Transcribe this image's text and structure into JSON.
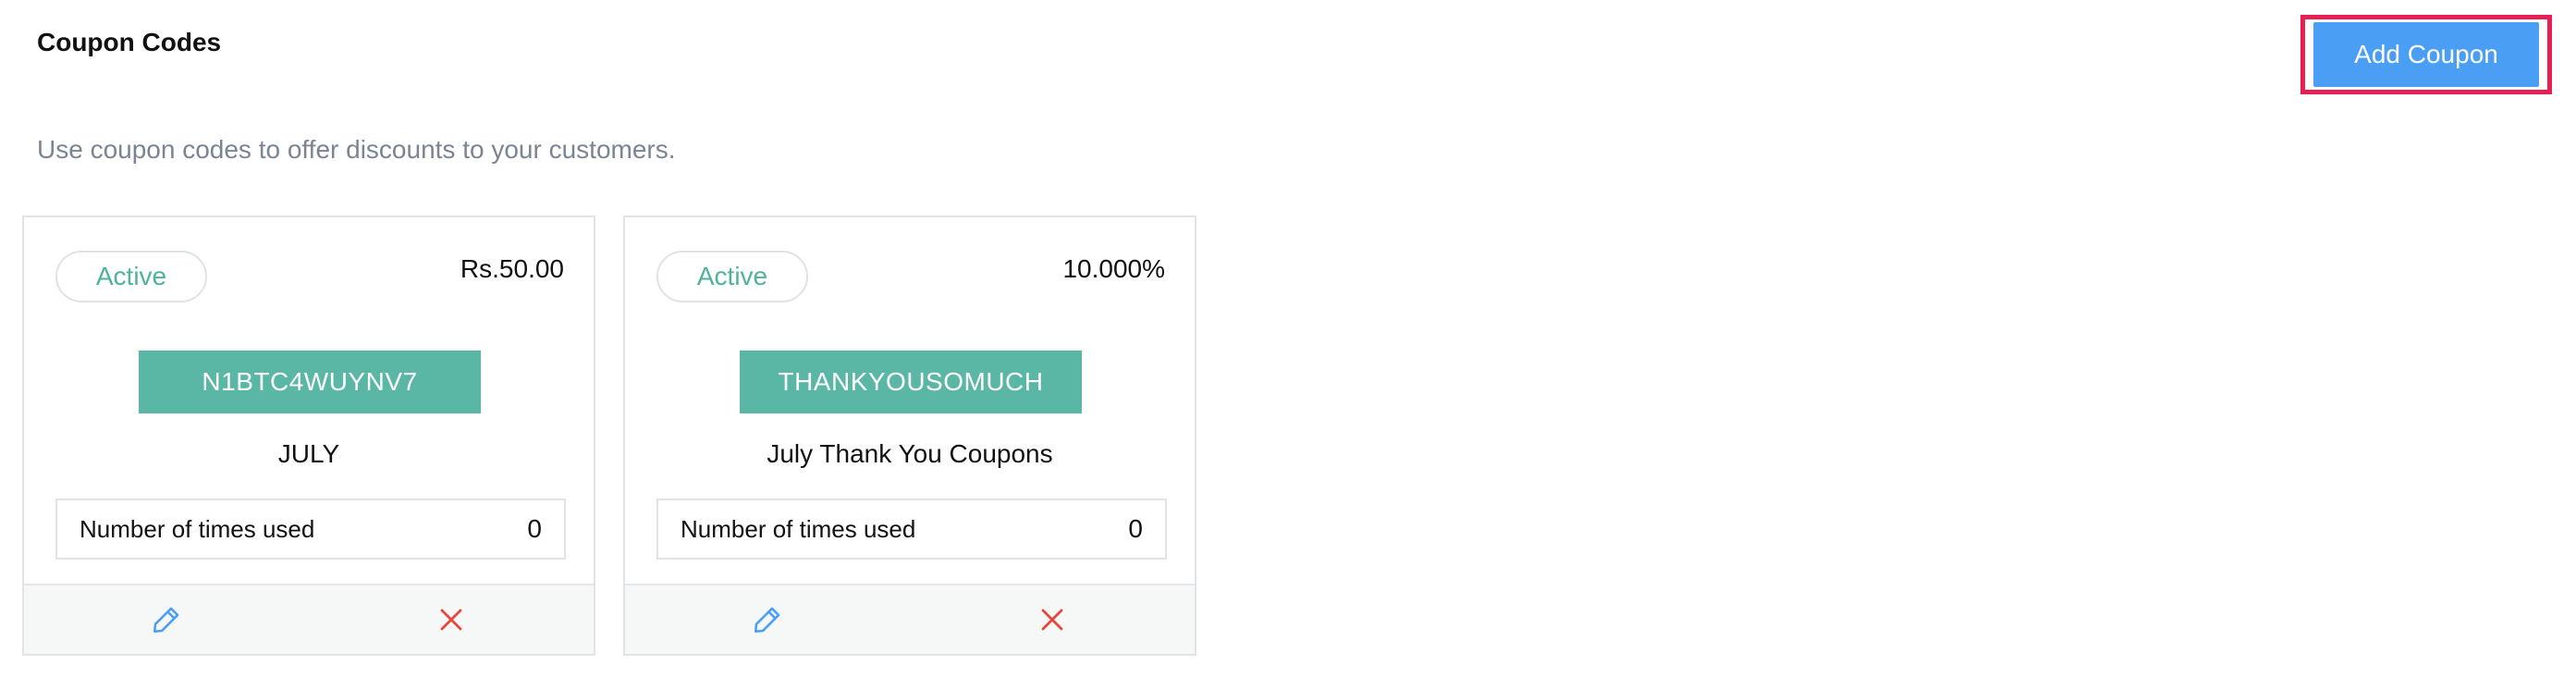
{
  "header": {
    "title": "Coupon Codes",
    "subtitle": "Use coupon codes to offer discounts to your customers.",
    "add_button_label": "Add Coupon"
  },
  "coupons": [
    {
      "status": "Active",
      "value": "Rs.50.00",
      "code": "N1BTC4WUYNV7",
      "name": "JULY",
      "usage_label": "Number of times used",
      "usage_count": "0"
    },
    {
      "status": "Active",
      "value": "10.000%",
      "code": "THANKYOUSOMUCH",
      "name": "July Thank You Coupons",
      "usage_label": "Number of times used",
      "usage_count": "0"
    }
  ],
  "icons": {
    "edit": "pencil-icon",
    "delete": "close-icon"
  },
  "colors": {
    "accent_blue": "#4a9ff5",
    "status_green": "#4fb29c",
    "code_bg": "#5bb7a5",
    "delete_red": "#e5473b",
    "highlight_border": "#e91e55"
  }
}
